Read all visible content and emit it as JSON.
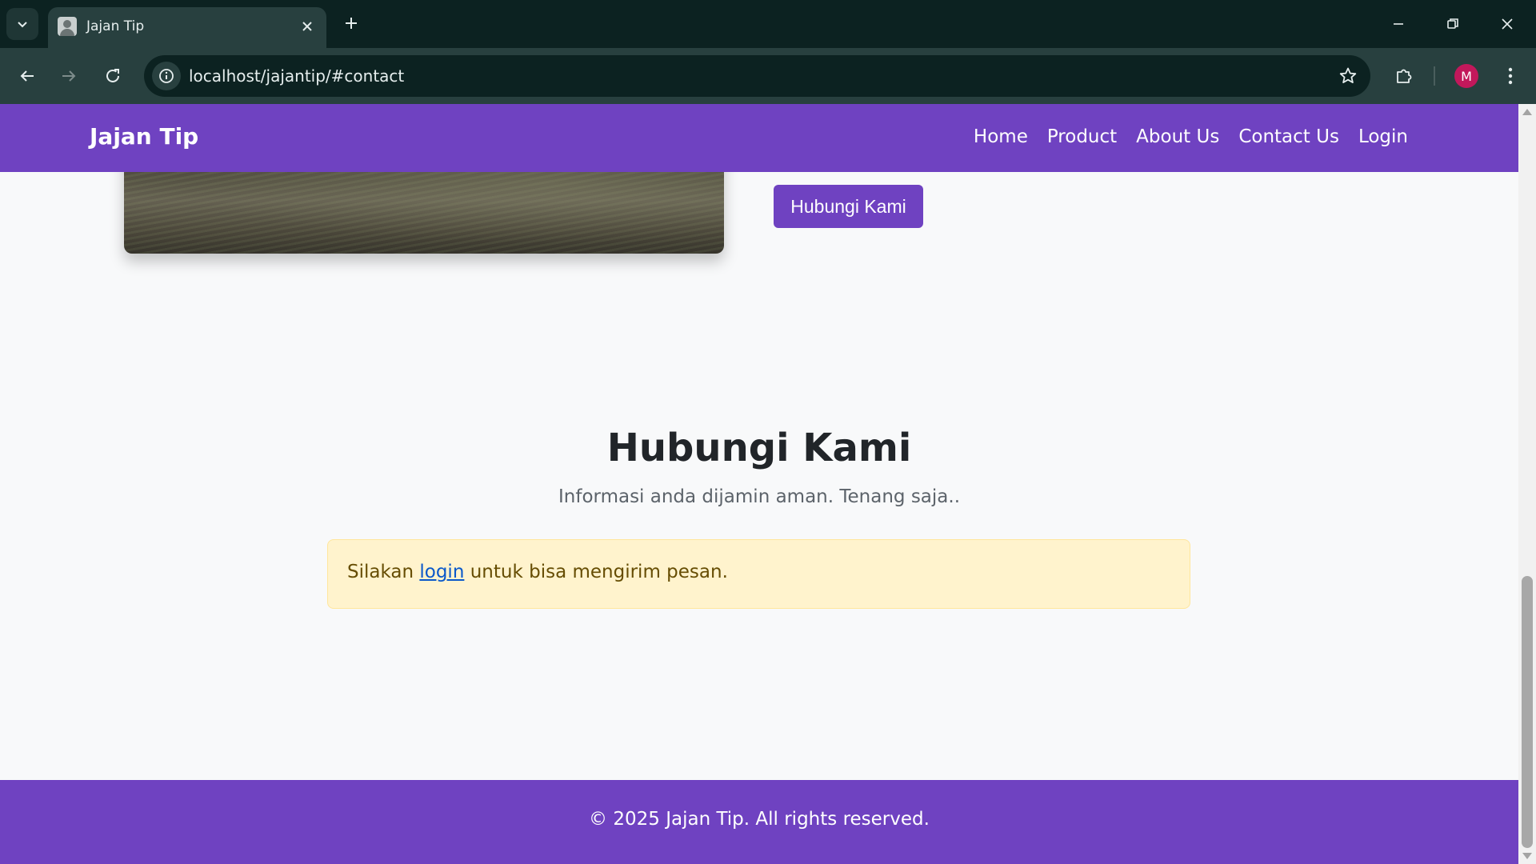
{
  "browser": {
    "tab_title": "Jajan Tip",
    "url": "localhost/jajantip/#contact",
    "profile_initial": "M",
    "profile_color": "#c2185b"
  },
  "navbar": {
    "brand": "Jajan Tip",
    "links": [
      "Home",
      "Product",
      "About Us",
      "Contact Us",
      "Login"
    ],
    "color": "#6f42c1"
  },
  "hero": {
    "button_label": "Hubungi Kami"
  },
  "contact": {
    "title": "Hubungi Kami",
    "subtitle": "Informasi anda dijamin aman. Tenang saja..",
    "alert_prefix": "Silakan ",
    "alert_link": "login",
    "alert_suffix": " untuk bisa mengirim pesan."
  },
  "footer": {
    "text": "© 2025 Jajan Tip. All rights reserved."
  },
  "icons": {
    "tab_search": "chevron-down-icon",
    "close": "close-icon",
    "new_tab": "plus-icon",
    "back": "arrow-left-icon",
    "forward": "arrow-right-icon",
    "reload": "reload-icon",
    "site_info": "info-icon",
    "bookmark": "star-icon",
    "extensions": "puzzle-icon",
    "menu": "kebab-menu-icon"
  }
}
